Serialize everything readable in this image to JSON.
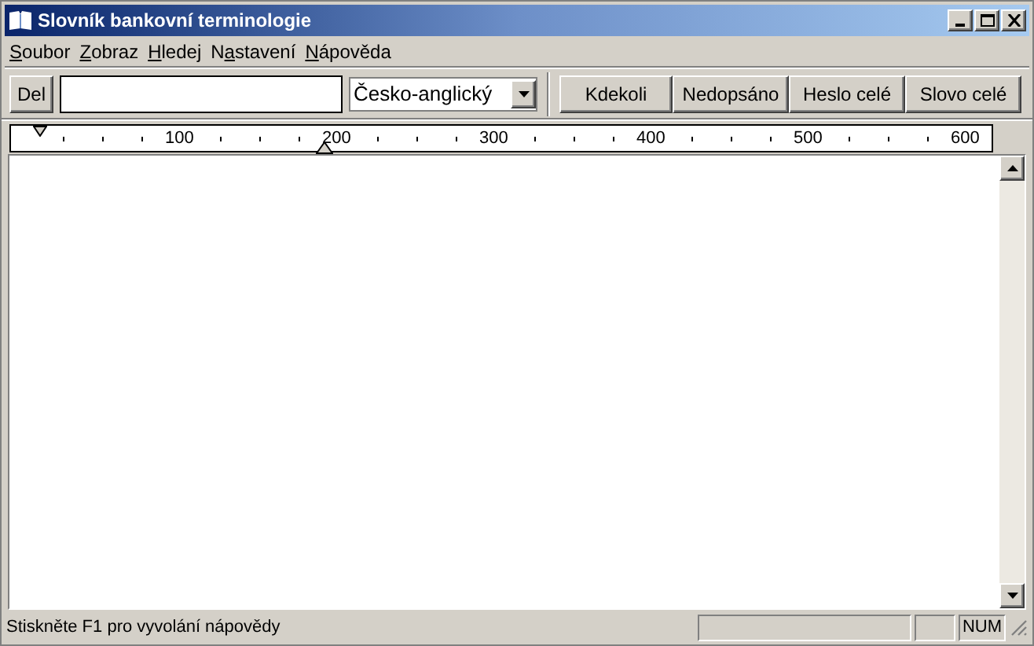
{
  "window": {
    "title": "Slovník bankovní terminologie"
  },
  "menu": [
    {
      "accel": "S",
      "after": "oubor"
    },
    {
      "accel": "Z",
      "after": "obraz"
    },
    {
      "accel": "H",
      "after": "ledej"
    },
    {
      "before": "N",
      "accel": "a",
      "after": "stavení"
    },
    {
      "accel": "N",
      "after": "ápověda"
    }
  ],
  "toolbar": {
    "del_button": "Del",
    "language": "Česko-anglický",
    "mode_buttons": [
      "Kdekoli",
      "Nedopsáno",
      "Heslo celé",
      "Slovo celé"
    ]
  },
  "ruler": {
    "labels": [
      "100",
      "200",
      "300",
      "400",
      "500",
      "600"
    ]
  },
  "status_bar": {
    "message": "Stiskněte F1 pro vyvolání nápovědy",
    "num": "NUM"
  }
}
